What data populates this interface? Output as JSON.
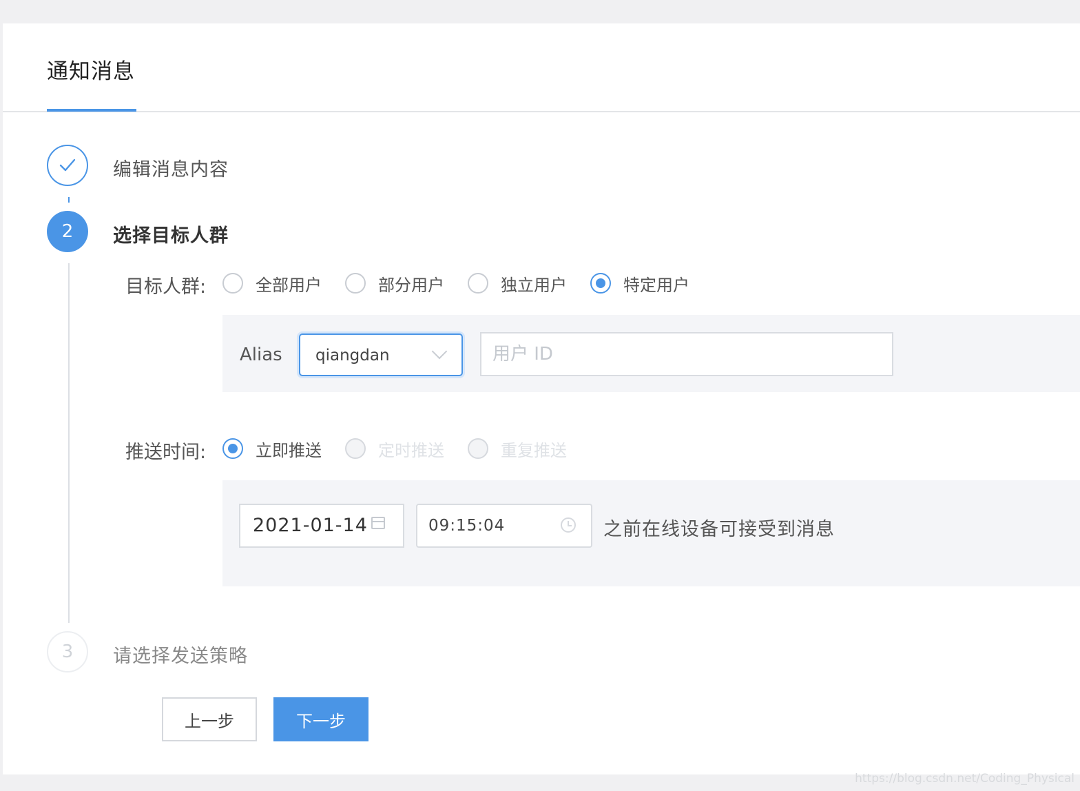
{
  "header": {
    "tab_title": "通知消息"
  },
  "colors": {
    "accent": "#4a95e6",
    "panel_background": "#ffffff",
    "page_background": "#f0f0f2",
    "section_background": "#f4f5f8"
  },
  "steps": [
    {
      "index_label": "",
      "status": "done",
      "icon": "check-icon",
      "title": "编辑消息内容"
    },
    {
      "index_label": "2",
      "status": "active",
      "title": "选择目标人群"
    },
    {
      "index_label": "3",
      "status": "pending",
      "title": "请选择发送策略"
    }
  ],
  "target": {
    "label": "目标人群:",
    "options": [
      {
        "label": "全部用户",
        "checked": false,
        "disabled": false
      },
      {
        "label": "部分用户",
        "checked": false,
        "disabled": false
      },
      {
        "label": "独立用户",
        "checked": false,
        "disabled": false
      },
      {
        "label": "特定用户",
        "checked": true,
        "disabled": false
      }
    ],
    "alias_label": "Alias",
    "alias_select_value": "qiangdan",
    "userid_placeholder": "用户 ID"
  },
  "push_time": {
    "label": "推送时间:",
    "options": [
      {
        "label": "立即推送",
        "checked": true,
        "disabled": false
      },
      {
        "label": "定时推送",
        "checked": false,
        "disabled": true
      },
      {
        "label": "重复推送",
        "checked": false,
        "disabled": true
      }
    ],
    "date_value": "2021-01-14",
    "time_value": "09:15:04",
    "hint": "之前在线设备可接受到消息"
  },
  "buttons": {
    "prev_label": "上一步",
    "next_label": "下一步"
  },
  "watermark": "https://blog.csdn.net/Coding_Physical"
}
